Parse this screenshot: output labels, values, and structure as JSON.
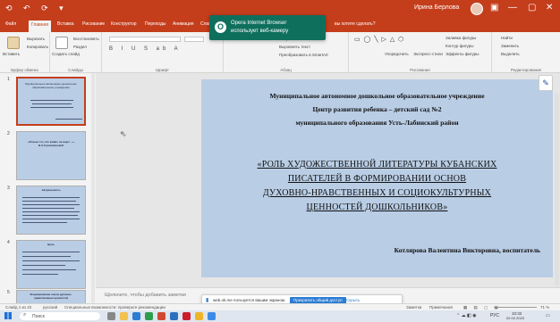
{
  "titlebar": {
    "quick_access": "⟲ ↶ ⟳ ▾",
    "user_name": "Ирина Берлова",
    "minimize": "—",
    "maximize": "▢",
    "close": "✕"
  },
  "ribbon_tabs": [
    {
      "label": "Файл"
    },
    {
      "label": "Главная"
    },
    {
      "label": "Вставка"
    },
    {
      "label": "Рисование"
    },
    {
      "label": "Конструктор"
    },
    {
      "label": "Переходы"
    },
    {
      "label": "Анимация"
    },
    {
      "label": "Слайд-шоу"
    }
  ],
  "ribbon_right_hint": "вы хотите сделать?",
  "ribbon_groups": {
    "clipboard": {
      "label": "Буфер обмена",
      "paste": "Вставить",
      "cut": "Вырезать",
      "copy": "Копировать"
    },
    "slides": {
      "label": "Слайды",
      "new": "Создать слайд",
      "reset": "Восстановить",
      "section": "Раздел"
    },
    "font": {
      "label": "Шрифт"
    },
    "paragraph": {
      "label": "Абзац",
      "dir": "Направление текста",
      "align": "Выровнять текст",
      "smart": "Преобразовать в SmartArt"
    },
    "drawing": {
      "label": "Рисование",
      "arrange": "Упорядочить",
      "styles": "Экспресс-стили",
      "fill": "Заливка фигуры",
      "outline": "Контур фигуры",
      "effects": "Эффекты фигуры"
    },
    "editing": {
      "label": "Редактирование",
      "find": "Найти",
      "replace": "Заменить",
      "select": "Выделить"
    }
  },
  "toast": {
    "line1": "Opera Internet Browser",
    "line2": "использует веб-камеру"
  },
  "thumbnails": [
    {
      "num": "1",
      "caption": "Муниципальное автономное дошкольное образовательное учреждение"
    },
    {
      "num": "2",
      "caption": "«Только тот, кто живёт, не ищет ...» В.А.Сухомлинский"
    },
    {
      "num": "3",
      "caption": "Актуальность"
    },
    {
      "num": "4",
      "caption": "Цель"
    },
    {
      "num": "5",
      "caption": "Формирование основ духовно-нравственных ценностей"
    }
  ],
  "slide": {
    "org_line1": "Муниципальное автономное дошкольное образовательное учреждение",
    "org_line2": "Центр развития ребенка – детский сад №2",
    "org_line3": "муниципального образования Усть-Лабинский район",
    "title_line1": "«РОЛЬ ХУДОЖЕСТВЕННОЙ ЛИТЕРАТУРЫ КУБАНСКИХ",
    "title_line2": "ПИСАТЕЛЕЙ В ФОРМИРОВАНИИ ОСНОВ",
    "title_line3": "ДУХОВНО-НРАВСТВЕННЫХ И СОЦИОКУЛЬТУРНЫХ",
    "title_line4": "ЦЕННОСТЕЙ ДОШКОЛЬНИКОВ»",
    "author": "Котлярова Валентина Викторовна, воспитатель"
  },
  "notes_placeholder": "Щелкните, чтобы добавить заметки",
  "share_banner": {
    "text": "web.ok.me пользуется вашим экраном.",
    "button": "Прекратить общий доступ",
    "hide": "Скрыть"
  },
  "statusbar": {
    "slide_info": "Слайд 1 из 22",
    "language": "русский",
    "accessibility": "Специальные возможности: проверьте рекомендации",
    "notes": "Заметки",
    "comments": "Примечания",
    "zoom": "71 %"
  },
  "taskbar": {
    "search_placeholder": "Поиск",
    "lang": "РУС",
    "time": "10:32",
    "date": "02.02.2023"
  },
  "colors": {
    "accent": "#c43e1c",
    "slide_bg": "#b9cde5",
    "toast_bg": "#0f6f5d"
  }
}
